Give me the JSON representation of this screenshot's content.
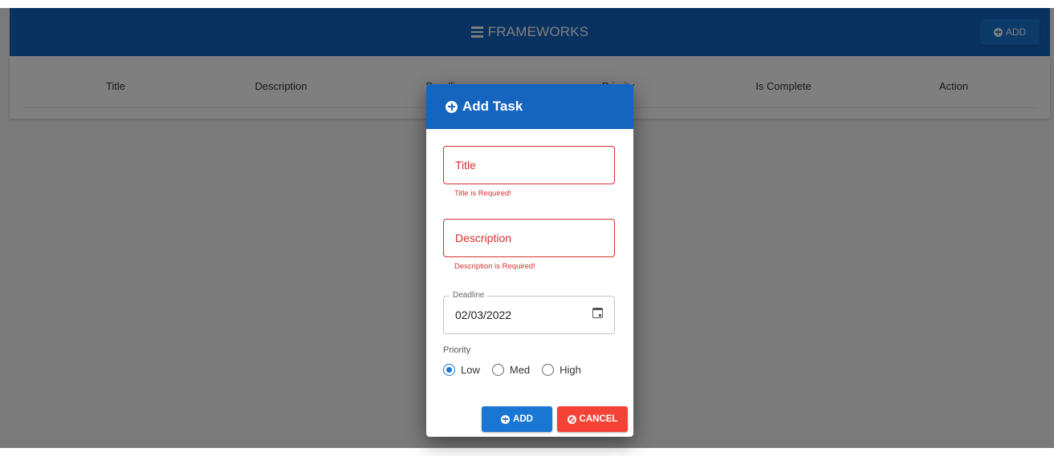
{
  "navbar": {
    "title": "FRAMEWORKS",
    "add_label": "ADD",
    "color": "#1565c0"
  },
  "table": {
    "columns": [
      "Title",
      "Description",
      "Deadline",
      "Priority",
      "Is Complete",
      "Action"
    ]
  },
  "dialog": {
    "title": "Add Task",
    "title_field": {
      "placeholder": "Title",
      "error": "Title is Required!"
    },
    "description_field": {
      "placeholder": "Description",
      "error": "Description is Required!"
    },
    "deadline_field": {
      "label": "Deadline",
      "value": "02/03/2022"
    },
    "priority": {
      "label": "Priority",
      "options": [
        "Low",
        "Med",
        "High"
      ],
      "selected": "Low"
    },
    "add_label": "ADD",
    "cancel_label": "CANCEL"
  },
  "colors": {
    "primary": "#1976d2",
    "error": "#d32f2f",
    "cancel": "#f44336"
  }
}
